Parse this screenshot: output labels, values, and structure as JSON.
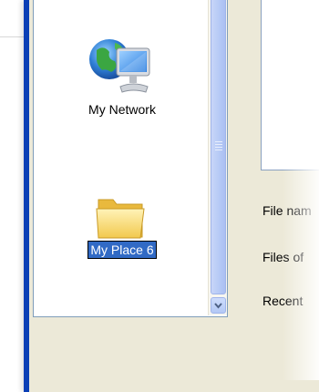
{
  "places": {
    "items": [
      {
        "label": "My Network",
        "icon": "network-globe-computer-icon",
        "selected": false
      },
      {
        "label": "My Place 6",
        "icon": "folder-icon",
        "selected": true
      }
    ]
  },
  "fields": {
    "file_name_label": "File nam",
    "files_of_type_label": "Files of",
    "recent_label": "Recent"
  },
  "colors": {
    "frame_blue": "#0a3fb6",
    "selection": "#316ac5",
    "dialog_bg": "#ece9d8"
  }
}
